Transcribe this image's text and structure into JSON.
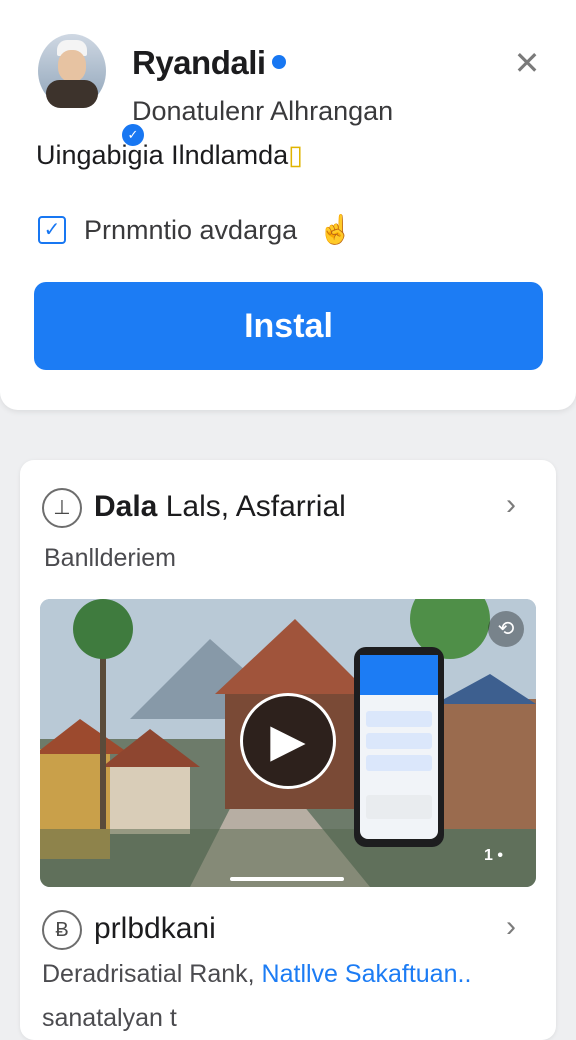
{
  "profile": {
    "name": "Ryandali",
    "subtitle": "Donatulenr Alhrangan",
    "description": "Uingabigia Ilndlamda",
    "description_accent": "▯",
    "checkbox_label": "Prnmntio avdarga"
  },
  "install_label": "Instal",
  "card": {
    "row1": {
      "title_bold": "Dala",
      "title_rest": "Lals, Asfarrial",
      "subtitle": "Banllderiem"
    },
    "video": {
      "counter": "1 •"
    },
    "row2": {
      "title": "prlbdkani",
      "sub_text": "Deradrisatial Rank,",
      "sub_link": "Natllve Sakaftuan..",
      "sub_line2": "sanatalyan t"
    }
  },
  "colors": {
    "accent": "#1c7cf4",
    "badge": "#1877f2"
  },
  "icons": {
    "close": "close-icon",
    "verified": "verified-badge-icon",
    "hand": "hand-icon",
    "play": "play-icon",
    "share": "share-icon"
  }
}
